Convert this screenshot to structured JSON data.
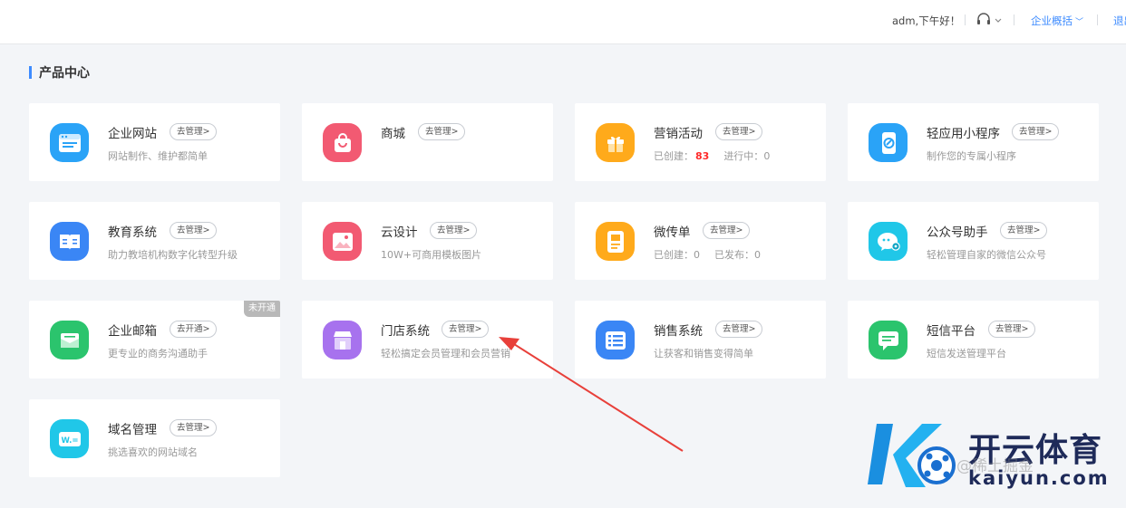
{
  "header": {
    "greeting": "adm,下午好！",
    "overview_label": "企业概括",
    "logout_label": "退出"
  },
  "section": {
    "title": "产品中心"
  },
  "cards": [
    {
      "name": "企业网站",
      "manage": "去管理>",
      "desc": "网站制作、维护都简单",
      "icon": "website-icon",
      "color": "#2aa3f7"
    },
    {
      "name": "商城",
      "manage": "去管理>",
      "desc": "",
      "icon": "shopping-bag-icon",
      "color": "#f25a72"
    },
    {
      "name": "营销活动",
      "manage": "去管理>",
      "icon": "gift-icon",
      "color": "#ffaa1b",
      "stat": {
        "created_label": "已创建：",
        "created_value": "83",
        "running_label": "进行中：",
        "running_value": "0"
      }
    },
    {
      "name": "轻应用小程序",
      "manage": "去管理>",
      "desc": "制作您的专属小程序",
      "icon": "mini-program-icon",
      "color": "#2aa3f7"
    },
    {
      "name": "教育系统",
      "manage": "去管理>",
      "desc": "助力教培机构数字化转型升级",
      "icon": "book-icon",
      "color": "#3a86f5"
    },
    {
      "name": "云设计",
      "manage": "去管理>",
      "desc": "10W+可商用模板图片",
      "icon": "image-icon",
      "color": "#f25a72"
    },
    {
      "name": "微传单",
      "manage": "去管理>",
      "icon": "flyer-icon",
      "color": "#ffaa1b",
      "stat": {
        "created_label": "已创建：",
        "created_value": "0",
        "published_label": "已发布：",
        "published_value": "0"
      }
    },
    {
      "name": "公众号助手",
      "manage": "去管理>",
      "desc": "轻松管理自家的微信公众号",
      "icon": "wechat-icon",
      "color": "#20c7e8"
    },
    {
      "name": "企业邮箱",
      "manage": "去开通>",
      "desc": "更专业的商务沟通助手",
      "icon": "mail-icon",
      "color": "#2bc46d",
      "badge": "未开通"
    },
    {
      "name": "门店系统",
      "manage": "去管理>",
      "desc": "轻松搞定会员管理和会员营销",
      "icon": "store-icon",
      "color": "#a772ee"
    },
    {
      "name": "销售系统",
      "manage": "去管理>",
      "desc": "让获客和销售变得简单",
      "icon": "list-icon",
      "color": "#3a86f5"
    },
    {
      "name": "短信平台",
      "manage": "去管理>",
      "desc": "短信发送管理平台",
      "icon": "sms-icon",
      "color": "#2bc46d"
    },
    {
      "name": "域名管理",
      "manage": "去管理>",
      "desc": "挑选喜欢的网站域名",
      "icon": "domain-icon",
      "color": "#20c7e8"
    }
  ],
  "watermark": {
    "brand_cn": "开云体育",
    "brand_en": "kaiyun.com",
    "faint_text": "@稀土掘金"
  }
}
